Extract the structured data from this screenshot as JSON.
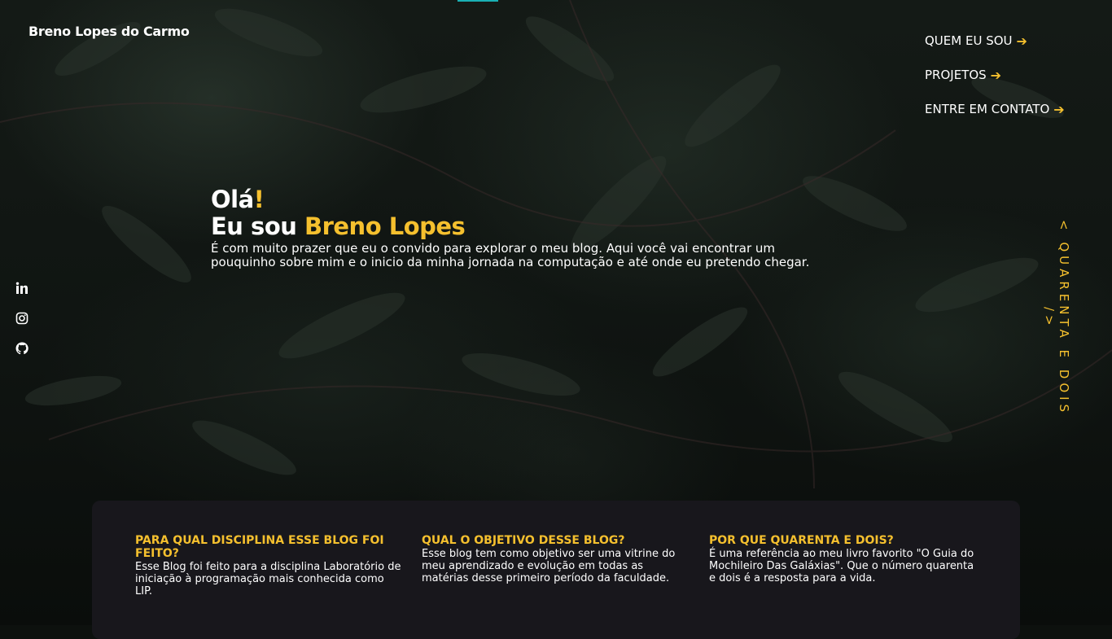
{
  "header": {
    "brand": "Breno Lopes do Carmo"
  },
  "nav": {
    "items": [
      {
        "label": "QUEM EU SOU"
      },
      {
        "label": "PROJETOS"
      },
      {
        "label": "ENTRE EM CONTATO"
      }
    ]
  },
  "social": {
    "icons": [
      "linkedin-icon",
      "instagram-icon",
      "github-icon"
    ]
  },
  "hero": {
    "greeting": "Olá",
    "greeting_mark": "!",
    "intro_prefix": "Eu sou ",
    "name": "Breno Lopes",
    "description": "É com muito prazer que eu o convido para explorar o meu blog. Aqui você vai encontrar um pouquinho sobre mim e o inicio da minha jornada na computação e até onde eu pretendo chegar."
  },
  "side_label": "< QUARENTA E DOIS />",
  "info": [
    {
      "title": "PARA QUAL DISCIPLINA ESSE BLOG FOI FEITO?",
      "text": "Esse Blog foi feito para a disciplina Laboratório de iniciação à programação mais conhecida como LIP."
    },
    {
      "title": "QUAL O OBJETIVO DESSE BLOG?",
      "text": "Esse blog tem como objetivo ser uma vitrine do meu aprendizado e evolução em todas as matérias desse primeiro período da faculdade."
    },
    {
      "title": "POR QUE QUARENTA E DOIS?",
      "text": "É uma referência ao meu livro favorito \"O Guia do Mochileiro Das Galáxias\". Que o número quarenta e dois é a resposta para a vida."
    }
  ],
  "colors": {
    "accent": "#f5c02e",
    "card_bg": "#18171c",
    "background": "#0d110e"
  }
}
